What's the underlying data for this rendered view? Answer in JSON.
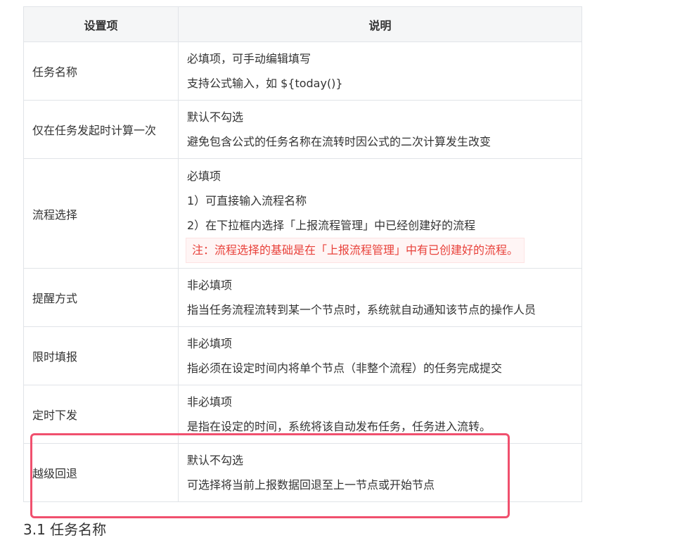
{
  "table": {
    "headers": [
      "设置项",
      "说明"
    ],
    "rows": [
      {
        "name": "任务名称",
        "lines": [
          "必填项，可手动编辑填写",
          "支持公式输入，如 ${today()}"
        ]
      },
      {
        "name": "仅在任务发起时计算一次",
        "lines": [
          "默认不勾选",
          "避免包含公式的任务名称在流转时因公式的二次计算发生改变"
        ]
      },
      {
        "name": "流程选择",
        "lines": [
          "必填项",
          "1）可直接输入流程名称",
          "2）在下拉框内选择「上报流程管理」中已经创建好的流程"
        ],
        "note": "注：流程选择的基础是在「上报流程管理」中有已创建好的流程。"
      },
      {
        "name": "提醒方式",
        "lines": [
          "非必填项",
          "指当任务流程流转到某一个节点时，系统就自动通知该节点的操作人员"
        ]
      },
      {
        "name": "限时填报",
        "lines": [
          "非必填项",
          "指必须在设定时间内将单个节点（非整个流程）的任务完成提交"
        ]
      },
      {
        "name": "定时下发",
        "lines": [
          "非必填项",
          "是指在设定的时间，系统将该自动发布任务，任务进入流转。"
        ]
      },
      {
        "name": "越级回退",
        "lines": [
          "默认不勾选",
          "可选择将当前上报数据回退至上一节点或开始节点"
        ]
      }
    ]
  },
  "next_heading": "3.1 任务名称",
  "colors": {
    "highlight_border": "#f0506e",
    "note_text": "#e8413a",
    "header_bg": "#f5f6f7"
  }
}
